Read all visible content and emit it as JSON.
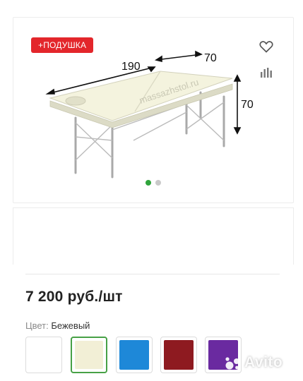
{
  "product": {
    "badge": "+ПОДУШКА",
    "dimensions": {
      "length": "190",
      "width": "70",
      "height": "70"
    },
    "watermark_site": "massazhstol.ru",
    "gallery": {
      "count": 2,
      "active_index": 0
    }
  },
  "price": "7 200 руб./шт",
  "color": {
    "label": "Цвет:",
    "value": "Бежевый",
    "options": [
      {
        "name": "white",
        "hex": "#ffffff"
      },
      {
        "name": "beige",
        "hex": "#f2efd6",
        "selected": true
      },
      {
        "name": "blue",
        "hex": "#1e88d8"
      },
      {
        "name": "burgundy",
        "hex": "#8e1a20"
      },
      {
        "name": "purple",
        "hex": "#6a2aa0"
      }
    ]
  },
  "icons": {
    "favorite": "heart-icon",
    "compare": "bar-chart-icon",
    "brand": "avito-logo"
  },
  "colors": {
    "accent_green": "#2fa43b",
    "badge_red": "#e3262b"
  },
  "brand_logo_text": "Avito"
}
